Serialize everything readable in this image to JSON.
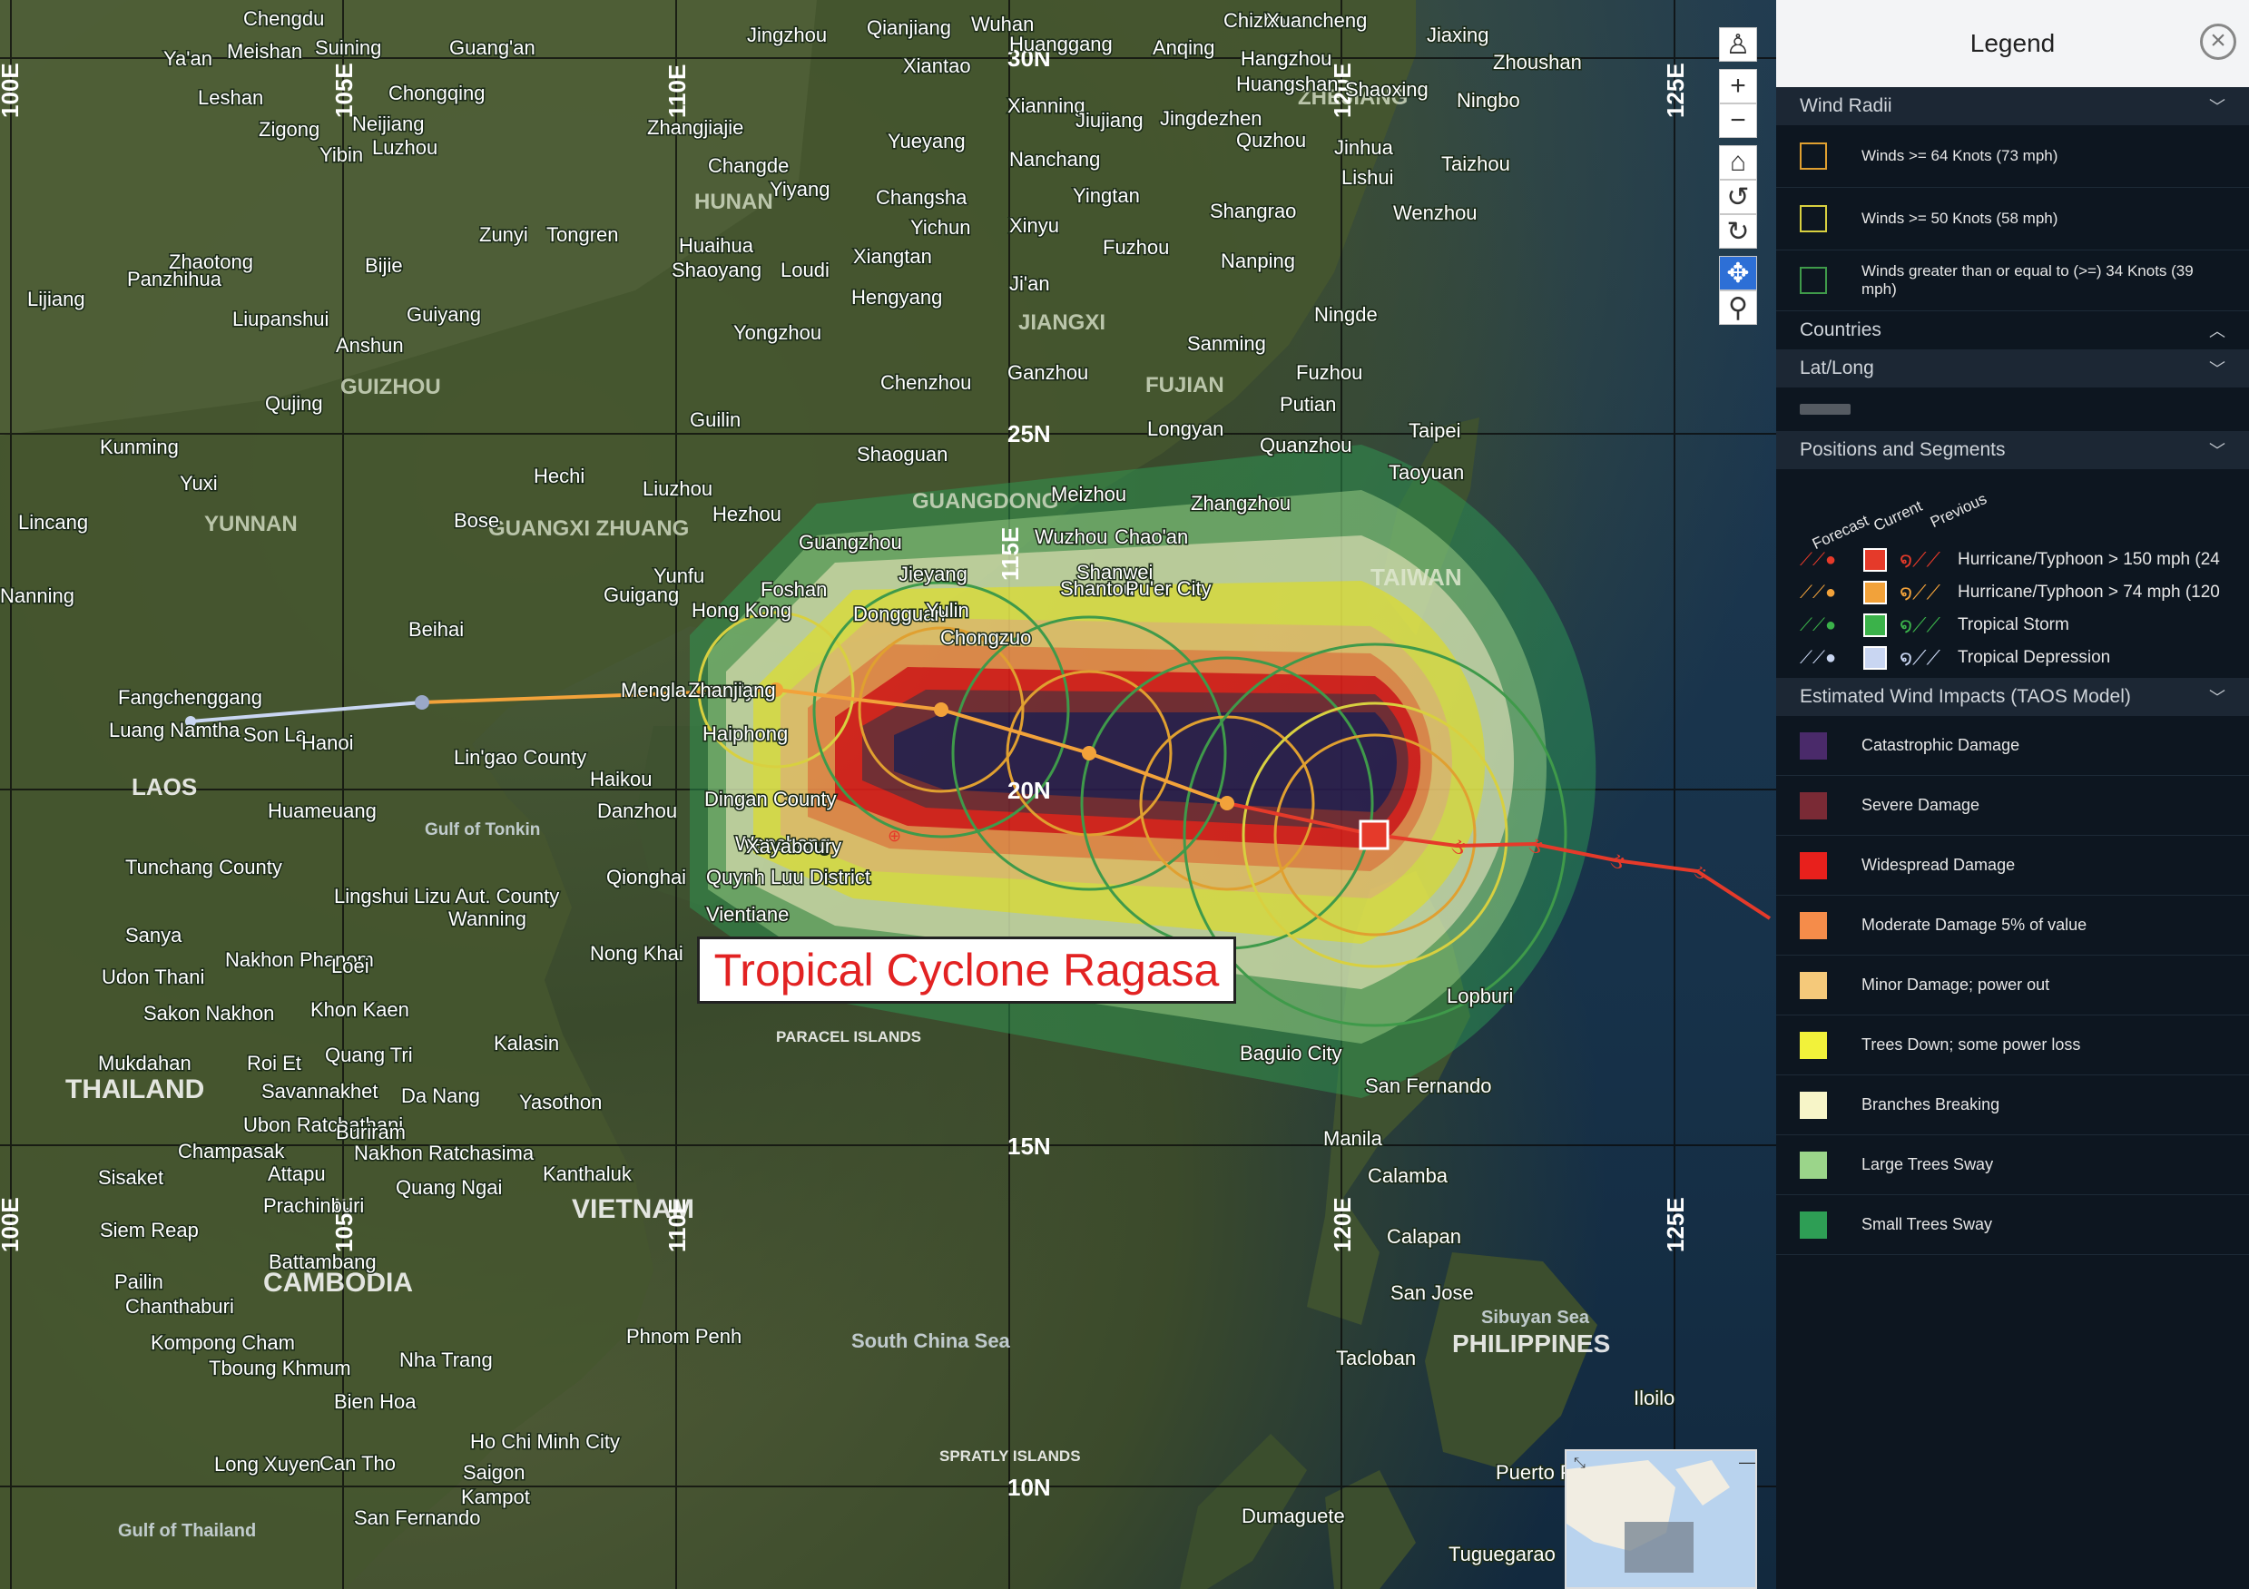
{
  "map": {
    "title": "Tropical Cyclone Ragasa",
    "cities": [
      {
        "name": "Chengdu"
      },
      {
        "name": "Ya'an"
      },
      {
        "name": "Meishan"
      },
      {
        "name": "Suining"
      },
      {
        "name": "Guang'an"
      },
      {
        "name": "Jingzhou"
      },
      {
        "name": "Qianjiang"
      },
      {
        "name": "Wuhan"
      },
      {
        "name": "Huanggang"
      },
      {
        "name": "Anqing"
      },
      {
        "name": "Chizhou"
      },
      {
        "name": "Xuancheng"
      },
      {
        "name": "Jiaxing"
      },
      {
        "name": "Xiantao"
      },
      {
        "name": "Hangzhou"
      },
      {
        "name": "Zhoushan"
      },
      {
        "name": "Leshan"
      },
      {
        "name": "Zigong"
      },
      {
        "name": "Neijiang"
      },
      {
        "name": "Chongqing"
      },
      {
        "name": "Zhangjiajie"
      },
      {
        "name": "Xianning"
      },
      {
        "name": "Jiujiang"
      },
      {
        "name": "Jingdezhen"
      },
      {
        "name": "Huangshan"
      },
      {
        "name": "Shaoxing"
      },
      {
        "name": "Ningbo"
      },
      {
        "name": "Yibin"
      },
      {
        "name": "Luzhou"
      },
      {
        "name": "Changde"
      },
      {
        "name": "Yueyang"
      },
      {
        "name": "Nanchang"
      },
      {
        "name": "Quzhou"
      },
      {
        "name": "Jinhua"
      },
      {
        "name": "Yiyang"
      },
      {
        "name": "Changsha"
      },
      {
        "name": "Yingtan"
      },
      {
        "name": "Lishui"
      },
      {
        "name": "Taizhou"
      },
      {
        "name": "Shangrao"
      },
      {
        "name": "Wenzhou"
      },
      {
        "name": "Zunyi"
      },
      {
        "name": "Tongren"
      },
      {
        "name": "Huaihua"
      },
      {
        "name": "Yichun"
      },
      {
        "name": "Xinyu"
      },
      {
        "name": "Zhaotong"
      },
      {
        "name": "Bijie"
      },
      {
        "name": "Shaoyang"
      },
      {
        "name": "Loudi"
      },
      {
        "name": "Xiangtan"
      },
      {
        "name": "Fuzhou"
      },
      {
        "name": "Nanping"
      },
      {
        "name": "Lijiang"
      },
      {
        "name": "Panzhihua"
      },
      {
        "name": "Liupanshui"
      },
      {
        "name": "Guiyang"
      },
      {
        "name": "Hengyang"
      },
      {
        "name": "Ji'an"
      },
      {
        "name": "Ningde"
      },
      {
        "name": "Anshun"
      },
      {
        "name": "Yongzhou"
      },
      {
        "name": "Ganzhou"
      },
      {
        "name": "Sanming"
      },
      {
        "name": "Fuzhou"
      },
      {
        "name": "Qujing"
      },
      {
        "name": "Chenzhou"
      },
      {
        "name": "Putian"
      },
      {
        "name": "Kunming"
      },
      {
        "name": "Guilin"
      },
      {
        "name": "Longyan"
      },
      {
        "name": "Quanzhou"
      },
      {
        "name": "Taipei"
      },
      {
        "name": "Shaoguan"
      },
      {
        "name": "Taoyuan"
      },
      {
        "name": "Yuxi"
      },
      {
        "name": "Hechi"
      },
      {
        "name": "Liuzhou"
      },
      {
        "name": "Meizhou"
      },
      {
        "name": "Zhangzhou"
      },
      {
        "name": "Lincang"
      },
      {
        "name": "Bose"
      },
      {
        "name": "Hezhou"
      },
      {
        "name": "Chao'an"
      },
      {
        "name": "Wuzhou"
      },
      {
        "name": "Guangzhou"
      },
      {
        "name": "Jieyang"
      },
      {
        "name": "Shanwei"
      },
      {
        "name": "Shantou"
      },
      {
        "name": "Pu'er City"
      },
      {
        "name": "Nanning"
      },
      {
        "name": "Guigang"
      },
      {
        "name": "Yunfu"
      },
      {
        "name": "Foshan"
      },
      {
        "name": "Dongguan"
      },
      {
        "name": "Yulin"
      },
      {
        "name": "Hong Kong"
      },
      {
        "name": "Chongzuo"
      },
      {
        "name": "Beihai"
      },
      {
        "name": "Mengla County"
      },
      {
        "name": "Fangchenggang"
      },
      {
        "name": "Luang Namtha"
      },
      {
        "name": "Son La"
      },
      {
        "name": "Hanoi"
      },
      {
        "name": "Zhanjiang"
      },
      {
        "name": "Haiphong"
      },
      {
        "name": "Lin'gao County"
      },
      {
        "name": "Haikou"
      },
      {
        "name": "Huameuang"
      },
      {
        "name": "Danzhou"
      },
      {
        "name": "Dingan County"
      },
      {
        "name": "Wenchang"
      },
      {
        "name": "Xayaboury"
      },
      {
        "name": "Tunchang County"
      },
      {
        "name": "Qionghai"
      },
      {
        "name": "Quynh Luu District"
      },
      {
        "name": "Lingshui Lizu Aut. County"
      },
      {
        "name": "Wanning"
      },
      {
        "name": "Vientiane"
      },
      {
        "name": "Sanya"
      },
      {
        "name": "Nong Khai"
      },
      {
        "name": "Nakhon Phanom"
      },
      {
        "name": "Loei"
      },
      {
        "name": "Udon Thani"
      },
      {
        "name": "Sakon Nakhon"
      },
      {
        "name": "Khon Kaen"
      },
      {
        "name": "Mukdahan"
      },
      {
        "name": "Quang Tri"
      },
      {
        "name": "Kalasin"
      },
      {
        "name": "Roi Et"
      },
      {
        "name": "Savannakhet"
      },
      {
        "name": "Da Nang"
      },
      {
        "name": "Yasothon"
      },
      {
        "name": "Ubon Ratchathani"
      },
      {
        "name": "Buriram"
      },
      {
        "name": "Champasak"
      },
      {
        "name": "Nakhon Ratchasima"
      },
      {
        "name": "Sisaket"
      },
      {
        "name": "Attapu"
      },
      {
        "name": "Quang Ngai"
      },
      {
        "name": "Kanthaluk"
      },
      {
        "name": "Prachinburi"
      },
      {
        "name": "Siem Reap"
      },
      {
        "name": "Battambang"
      },
      {
        "name": "Pailin"
      },
      {
        "name": "Chanthaburi"
      },
      {
        "name": "Kompong Cham"
      },
      {
        "name": "Tboung Khmum"
      },
      {
        "name": "Nha Trang"
      },
      {
        "name": "Phnom Penh"
      },
      {
        "name": "Bien Hoa"
      },
      {
        "name": "Ho Chi Minh City"
      },
      {
        "name": "Saigon"
      },
      {
        "name": "Kampot"
      },
      {
        "name": "Long Xuyen"
      },
      {
        "name": "Can Tho"
      },
      {
        "name": "San Fernando"
      },
      {
        "name": "Baguio City"
      },
      {
        "name": "San Fernando"
      },
      {
        "name": "Manila"
      },
      {
        "name": "Calamba"
      },
      {
        "name": "Calapan"
      },
      {
        "name": "San Jose"
      },
      {
        "name": "Tacloban"
      },
      {
        "name": "Iloilo"
      },
      {
        "name": "Puerto Princesa"
      },
      {
        "name": "Dumaguete"
      },
      {
        "name": "Tuguegarao"
      },
      {
        "name": "Lopburi"
      }
    ],
    "regions": [
      {
        "name": "HUNAN"
      },
      {
        "name": "JIANGXI"
      },
      {
        "name": "ZHEJIANG"
      },
      {
        "name": "FUJIAN"
      },
      {
        "name": "GUIZHOU"
      },
      {
        "name": "YUNNAN"
      },
      {
        "name": "GUANGXI ZHUANG"
      },
      {
        "name": "GUANGDONG"
      },
      {
        "name": "TAIWAN"
      },
      {
        "name": "LAOS"
      },
      {
        "name": "THAILAND"
      },
      {
        "name": "CAMBODIA"
      },
      {
        "name": "VIETNAM"
      },
      {
        "name": "PHILIPPINES"
      },
      {
        "name": "PARACEL ISLANDS"
      },
      {
        "name": "SPRATLY ISLANDS"
      },
      {
        "name": "Gulf of Tonkin"
      },
      {
        "name": "South China Sea"
      },
      {
        "name": "Sibuyan Sea"
      },
      {
        "name": "Gulf of Thailand"
      }
    ],
    "gridlines": {
      "lat": [
        "30N",
        "25N",
        "20N",
        "15N",
        "10N"
      ],
      "lon": [
        "100E",
        "105E",
        "110E",
        "115E",
        "120E",
        "125E"
      ]
    }
  },
  "controls": [
    {
      "name": "street-view-button",
      "icon": "person-icon",
      "glyph": "♙"
    },
    {
      "name": "zoom-in-button",
      "icon": "plus-icon",
      "glyph": "+"
    },
    {
      "name": "zoom-out-button",
      "icon": "minus-icon",
      "glyph": "−"
    },
    {
      "name": "home-button",
      "icon": "home-icon",
      "glyph": "⌂"
    },
    {
      "name": "rotate-left-button",
      "icon": "rotate-left-icon",
      "glyph": "↺"
    },
    {
      "name": "rotate-right-button",
      "icon": "rotate-right-icon",
      "glyph": "↻"
    },
    {
      "name": "pan-button",
      "icon": "move-icon",
      "glyph": "✥"
    },
    {
      "name": "zoom-box-button",
      "icon": "magnifier-icon",
      "glyph": "⚲"
    }
  ],
  "legend": {
    "title": "Legend",
    "close_icon": "close-icon",
    "wind_radii": {
      "header": "Wind Radii",
      "items": [
        {
          "label": "Winds >= 64 Knots (73 mph)",
          "color": "#e0a030"
        },
        {
          "label": "Winds >= 50 Knots (58 mph)",
          "color": "#d8d040"
        },
        {
          "label": "Winds greater than or equal to (>=) 34 Knots (39 mph)",
          "color": "#3f9a4a"
        }
      ]
    },
    "countries": {
      "header": "Countries"
    },
    "latlong": {
      "header": "Lat/Long"
    },
    "positions": {
      "header": "Positions and Segments",
      "columns": [
        "Forecast",
        "Current",
        "Previous"
      ],
      "items": [
        {
          "label": "Hurricane/Typhoon > 150 mph (24",
          "color": "#e53a2a"
        },
        {
          "label": "Hurricane/Typhoon > 74 mph (120",
          "color": "#f2a23a"
        },
        {
          "label": "Tropical Storm",
          "color": "#3bb24a"
        },
        {
          "label": "Tropical Depression",
          "color": "#c9d6f2"
        }
      ]
    },
    "impacts": {
      "header": "Estimated Wind Impacts (TAOS Model)",
      "items": [
        {
          "label": "Catastrophic Damage",
          "color": "#4a2a6a"
        },
        {
          "label": "Severe Damage",
          "color": "#7a2a35"
        },
        {
          "label": "Widespread Damage",
          "color": "#e8201c"
        },
        {
          "label": "Moderate Damage 5% of value",
          "color": "#f58c4a"
        },
        {
          "label": "Minor Damage; power out",
          "color": "#f5c97a"
        },
        {
          "label": "Trees Down; some power loss",
          "color": "#f2f23a"
        },
        {
          "label": "Branches Breaking",
          "color": "#f7f5c8"
        },
        {
          "label": "Large Trees Sway",
          "color": "#9bd58a"
        },
        {
          "label": "Small Trees Sway",
          "color": "#2e9e55"
        }
      ]
    }
  }
}
